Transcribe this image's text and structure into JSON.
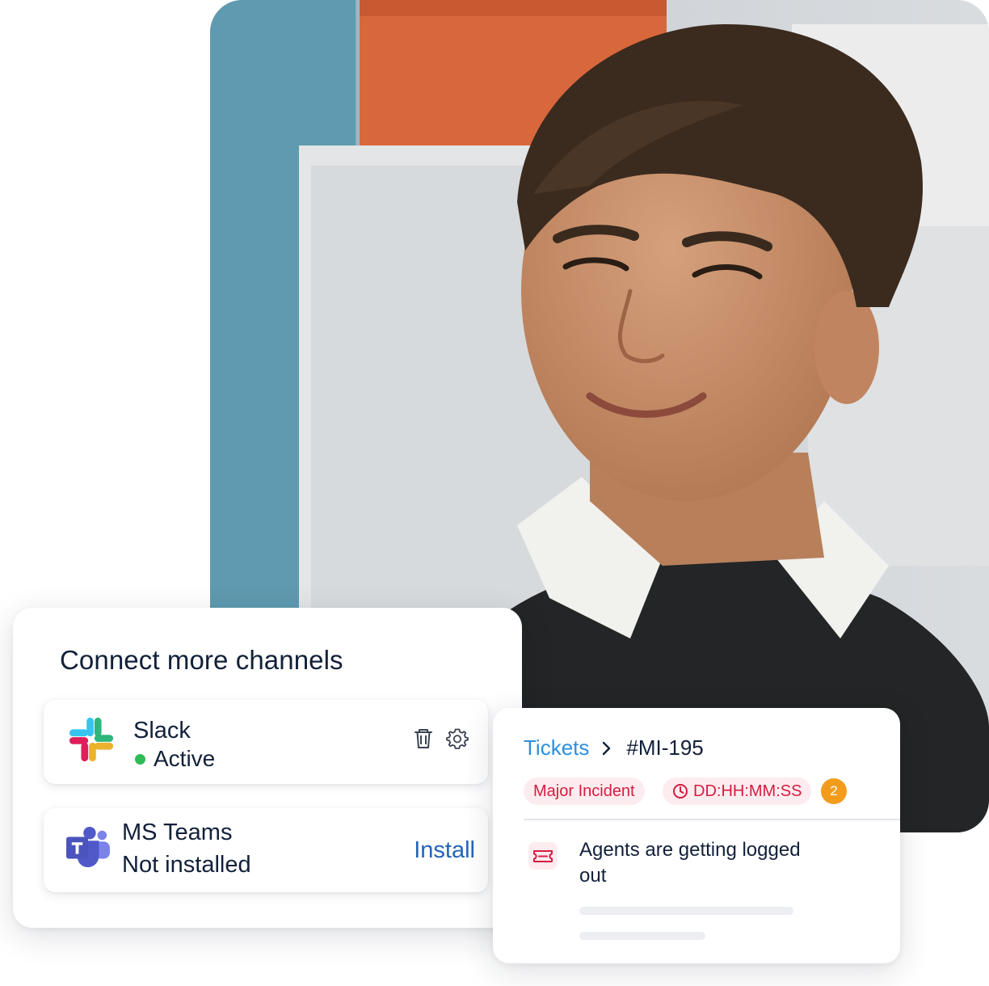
{
  "hero": {
    "image": "smiling-person-photo"
  },
  "channels": {
    "title": "Connect more channels",
    "items": [
      {
        "name": "Slack",
        "status": "Active",
        "status_color": "#2fbb57",
        "icon": "slack-logo-icon",
        "actions": [
          "trash-icon",
          "gear-icon"
        ]
      },
      {
        "name": "MS Teams",
        "status": "Not installed",
        "icon": "ms-teams-logo-icon",
        "action_label": "Install"
      }
    ]
  },
  "ticket": {
    "breadcrumb_link": "Tickets",
    "ticket_id": "#MI-195",
    "tag_label": "Major Incident",
    "timer_label": "DD:HH:MM:SS",
    "badge_count": "2",
    "subject": "Agents are getting logged out",
    "icon": "ticket-icon"
  },
  "colors": {
    "accent_blue": "#2c8fe0",
    "link_blue": "#2264b8",
    "incident_red": "#d81b3f",
    "badge_orange": "#f39c1c",
    "text_dark": "#12203a"
  }
}
